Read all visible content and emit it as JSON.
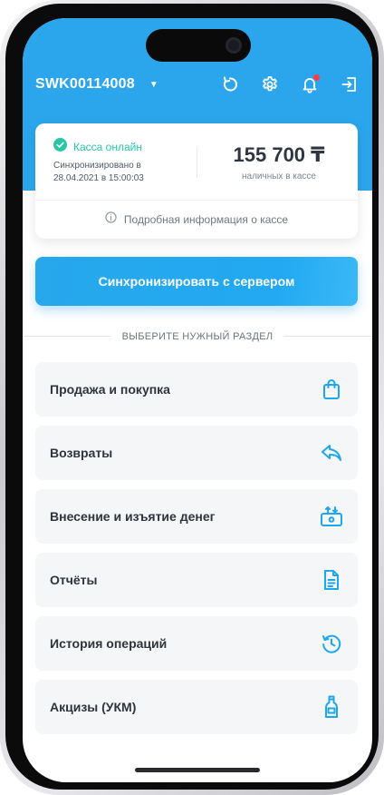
{
  "header": {
    "device_id": "SWK00114008",
    "icons": [
      "refresh-icon",
      "gear-icon",
      "bell-icon",
      "logout-icon"
    ]
  },
  "status": {
    "online_label": "Касса онлайн",
    "sync_label": "Синхронизировано в",
    "sync_time": "28.04.2021 в 15:00:03",
    "cash_amount": "155 700 ₸",
    "cash_label": "наличных в кассе",
    "info_link": "Подробная информация о кассе"
  },
  "sync_button_label": "Синхронизировать с сервером",
  "section_title": "ВЫБЕРИТЕ НУЖНЫЙ РАЗДЕЛ",
  "menu": [
    {
      "label": "Продажа и покупка",
      "icon": "shopping-bag-icon"
    },
    {
      "label": "Возвраты",
      "icon": "reply-arrow-icon"
    },
    {
      "label": "Внесение и изъятие денег",
      "icon": "cash-transfer-icon"
    },
    {
      "label": "Отчёты",
      "icon": "report-icon"
    },
    {
      "label": "История операций",
      "icon": "history-icon"
    },
    {
      "label": "Акцизы (УКМ)",
      "icon": "bottle-icon"
    }
  ],
  "colors": {
    "primary": "#2ba6ec",
    "online": "#28c6a7",
    "notification": "#ff3b47",
    "menu_bg": "#f5f6f8"
  }
}
